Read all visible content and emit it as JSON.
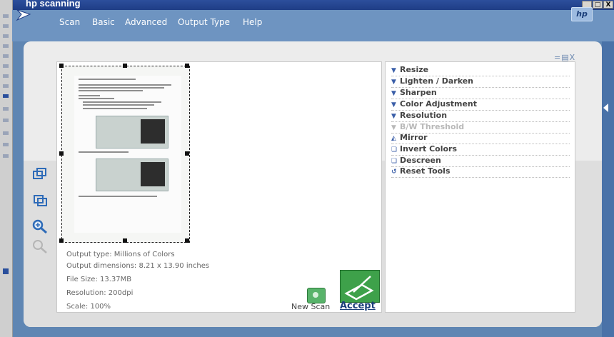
{
  "window": {
    "title": "hp scanning",
    "controls": [
      "_",
      "□",
      "X"
    ]
  },
  "menu": {
    "items": [
      "Scan",
      "Basic",
      "Advanced",
      "Output Type",
      "Help"
    ]
  },
  "brand": {
    "hp_logo": "hp"
  },
  "tools_panel": {
    "controls": "=▤X",
    "items": [
      {
        "label": "Resize",
        "icon": "triangle-down-icon",
        "enabled": true
      },
      {
        "label": "Lighten / Darken",
        "icon": "triangle-down-icon",
        "enabled": true
      },
      {
        "label": "Sharpen",
        "icon": "triangle-down-icon",
        "enabled": true
      },
      {
        "label": "Color Adjustment",
        "icon": "triangle-down-icon",
        "enabled": true
      },
      {
        "label": "Resolution",
        "icon": "triangle-down-icon",
        "enabled": true
      },
      {
        "label": "B/W Threshold",
        "icon": "triangle-down-icon",
        "enabled": false
      },
      {
        "label": "Mirror",
        "icon": "mirror-icon",
        "enabled": true
      },
      {
        "label": "Invert Colors",
        "icon": "invert-icon",
        "enabled": true
      },
      {
        "label": "Descreen",
        "icon": "descreen-icon",
        "enabled": true
      },
      {
        "label": "Reset Tools",
        "icon": "reset-icon",
        "enabled": true
      }
    ]
  },
  "info": {
    "output_type": "Output type: Millions of Colors",
    "output_dimensions": "Output dimensions: 8.21 x 13.90 inches",
    "file_size": "File Size: 13.37MB",
    "resolution": "Resolution:  200dpi",
    "scale": "Scale: 100%"
  },
  "actions": {
    "new_scan": "New Scan",
    "accept": "Accept"
  },
  "colors": {
    "accent": "#5f86b3",
    "accept_green": "#3ea14a",
    "link_blue": "#1c3f7a"
  }
}
